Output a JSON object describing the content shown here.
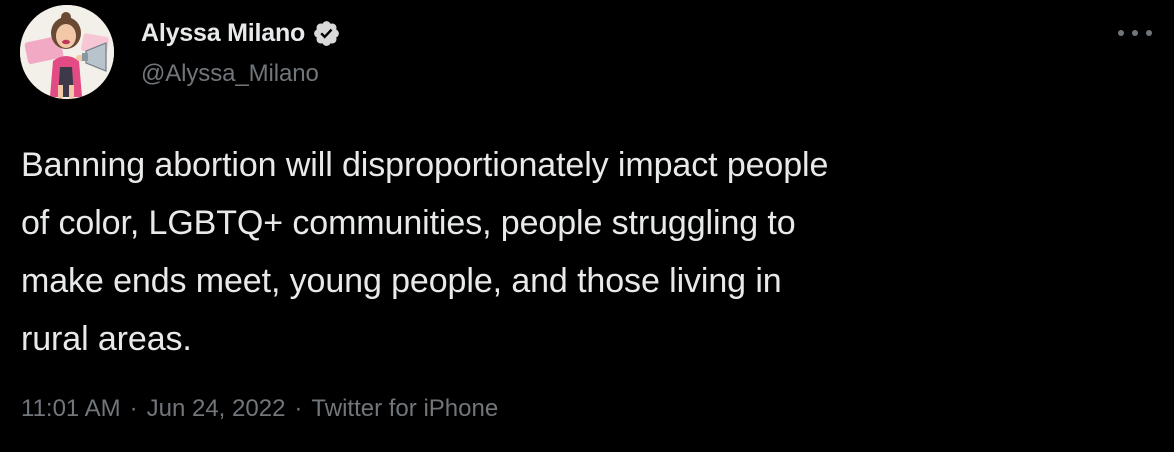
{
  "author": {
    "display_name": "Alyssa Milano",
    "handle": "@Alyssa_Milano",
    "verified": true,
    "avatar_icon": "avatar-illustration-megaphone"
  },
  "menu": {
    "more_icon": "more-horizontal-icon"
  },
  "tweet": {
    "text_lines": [
      "Banning abortion will disproportionately impact people",
      "of color, LGBTQ+ communities, people struggling to",
      "make ends meet, young people, and those living in",
      "rural areas."
    ]
  },
  "meta": {
    "time": "11:01 AM",
    "date": "Jun 24, 2022",
    "source": "Twitter for iPhone",
    "separator": "·"
  },
  "colors": {
    "background": "#000000",
    "primary_text": "#e7e9ea",
    "secondary_text": "#71767b",
    "verified_badge": "#d9d9d9"
  }
}
